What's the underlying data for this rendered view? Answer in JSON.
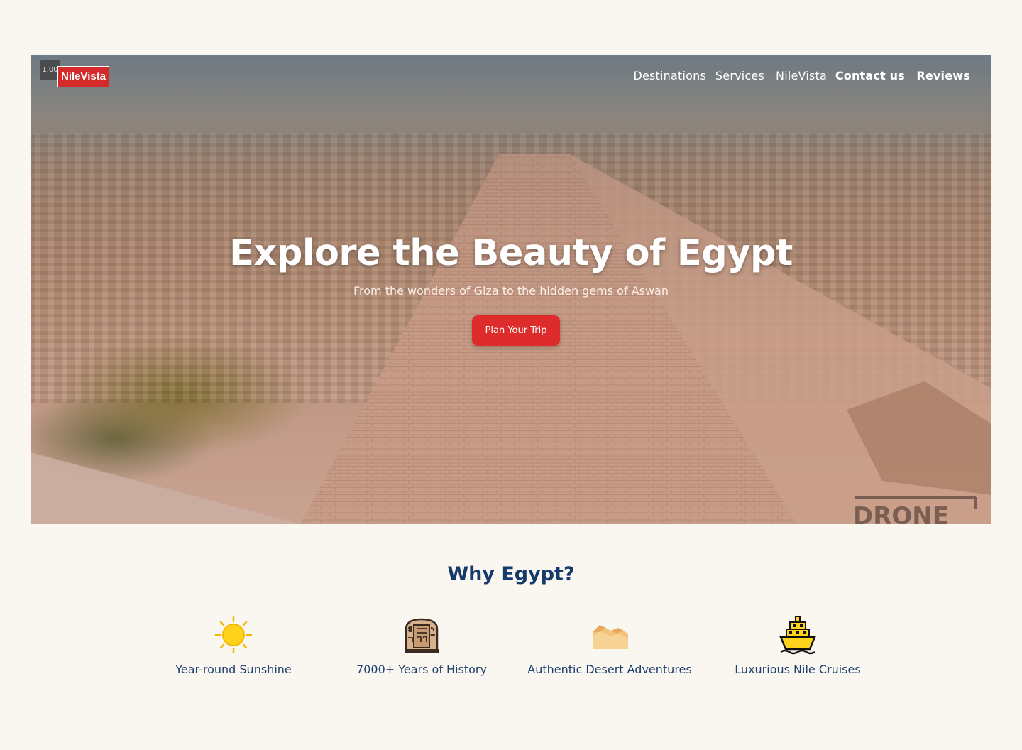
{
  "header": {
    "logo_badge": "1.00",
    "brand": "NileVista",
    "nav": [
      {
        "label": "Destinations",
        "bold": false
      },
      {
        "label": "Services",
        "bold": false
      },
      {
        "label": "NileVista",
        "bold": false
      },
      {
        "label": "Contact us",
        "bold": true
      },
      {
        "label": "Reviews",
        "bold": true
      }
    ]
  },
  "hero": {
    "title": "Explore the Beauty of Egypt",
    "subtitle": "From the wonders of Giza to the hidden gems of Aswan",
    "cta_label": "Plan Your Trip",
    "watermark_text": "DRONE"
  },
  "why": {
    "title": "Why Egypt?",
    "features": [
      {
        "label": "Year-round Sunshine",
        "icon": "sun-icon"
      },
      {
        "label": "7000+ Years of History",
        "icon": "hieroglyph-tablet-icon"
      },
      {
        "label": "Authentic Desert Adventures",
        "icon": "desert-dunes-icon"
      },
      {
        "label": "Luxurious Nile Cruises",
        "icon": "cruise-ship-icon"
      }
    ]
  },
  "colors": {
    "background": "#faf7f1",
    "accent_red": "#de2c2c",
    "heading_blue": "#163a6b"
  }
}
